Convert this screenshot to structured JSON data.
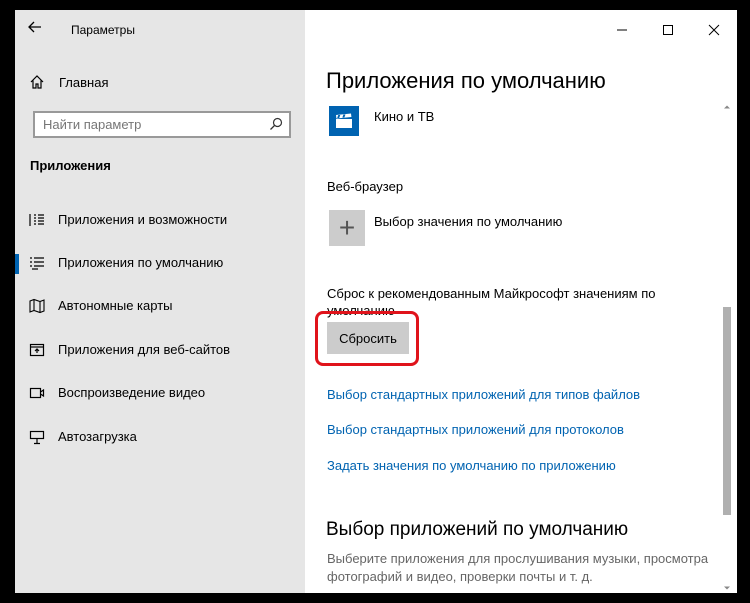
{
  "window": {
    "title": "Параметры"
  },
  "sidebar": {
    "home_label": "Главная",
    "search_placeholder": "Найти параметр",
    "section_title": "Приложения",
    "items": [
      {
        "label": "Приложения и возможности",
        "icon": "apps-list-icon",
        "selected": false
      },
      {
        "label": "Приложения по умолчанию",
        "icon": "default-apps-icon",
        "selected": true
      },
      {
        "label": "Автономные карты",
        "icon": "map-icon",
        "selected": false
      },
      {
        "label": "Приложения для веб-сайтов",
        "icon": "web-apps-icon",
        "selected": false
      },
      {
        "label": "Воспроизведение видео",
        "icon": "video-icon",
        "selected": false
      },
      {
        "label": "Автозагрузка",
        "icon": "startup-icon",
        "selected": false
      }
    ]
  },
  "main": {
    "page_title": "Приложения по умолчанию",
    "video_app_name": "Кино и ТВ",
    "browser_section_label": "Веб-браузер",
    "browser_value": "Выбор значения по умолчанию",
    "reset_description": "Сброс к рекомендованным Майкрософт значениям по умолчанию",
    "reset_button": "Сбросить",
    "links": [
      "Выбор стандартных приложений для типов файлов",
      "Выбор стандартных приложений для протоколов",
      "Задать значения по умолчанию по приложению"
    ],
    "section2_title": "Выбор приложений по умолчанию",
    "section2_desc": "Выберите приложения для прослушивания музыки, просмотра фотографий и видео, проверки почты и т. д."
  },
  "colors": {
    "accent": "#0063b1",
    "highlight": "#e0131b",
    "sidebar_bg": "#e6e6e6"
  }
}
